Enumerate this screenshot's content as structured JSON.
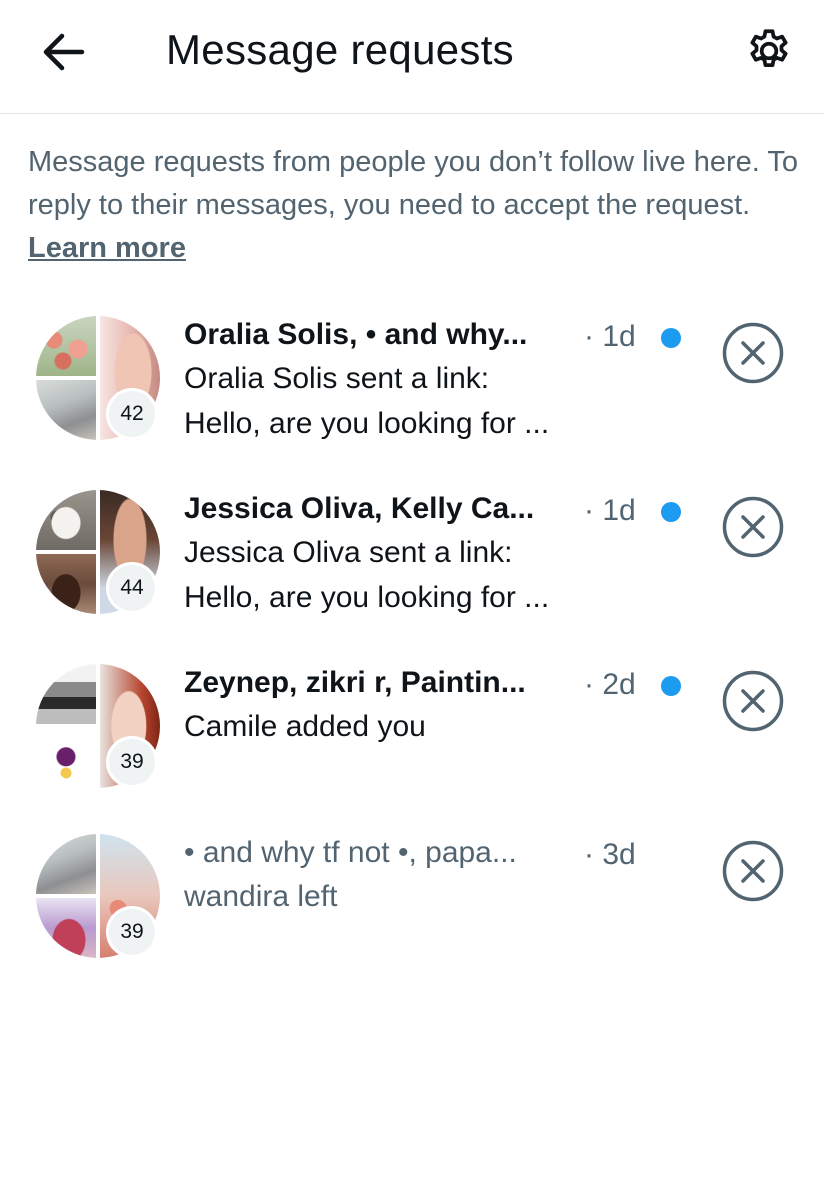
{
  "header": {
    "title": "Message requests"
  },
  "intro": {
    "text": "Message requests from people you don’t follow live here. To reply to their messages, you need to accept the request. ",
    "link": "Learn more"
  },
  "colors": {
    "accent": "#1d9bf0",
    "secondary_text": "#536471",
    "primary_text": "#0f1419"
  },
  "requests": [
    {
      "names": "Oralia Solis, • and why...",
      "time": "· 1d",
      "unread": true,
      "preview_1": "Oralia Solis sent a link:",
      "preview_2": "Hello, are you looking for ...",
      "member_count": "42"
    },
    {
      "names": "Jessica Oliva, Kelly Ca...",
      "time": "· 1d",
      "unread": true,
      "preview_1": "Jessica Oliva sent a link:",
      "preview_2": "Hello, are you looking for ...",
      "member_count": "44"
    },
    {
      "names": "Zeynep, zikri r, Paintin...",
      "time": "· 2d",
      "unread": true,
      "preview_1": "Camile added you",
      "member_count": "39"
    },
    {
      "names": "• and why tf not •, papa...",
      "time": "· 3d",
      "unread": false,
      "preview_1": "wandira left",
      "member_count": "39"
    }
  ]
}
